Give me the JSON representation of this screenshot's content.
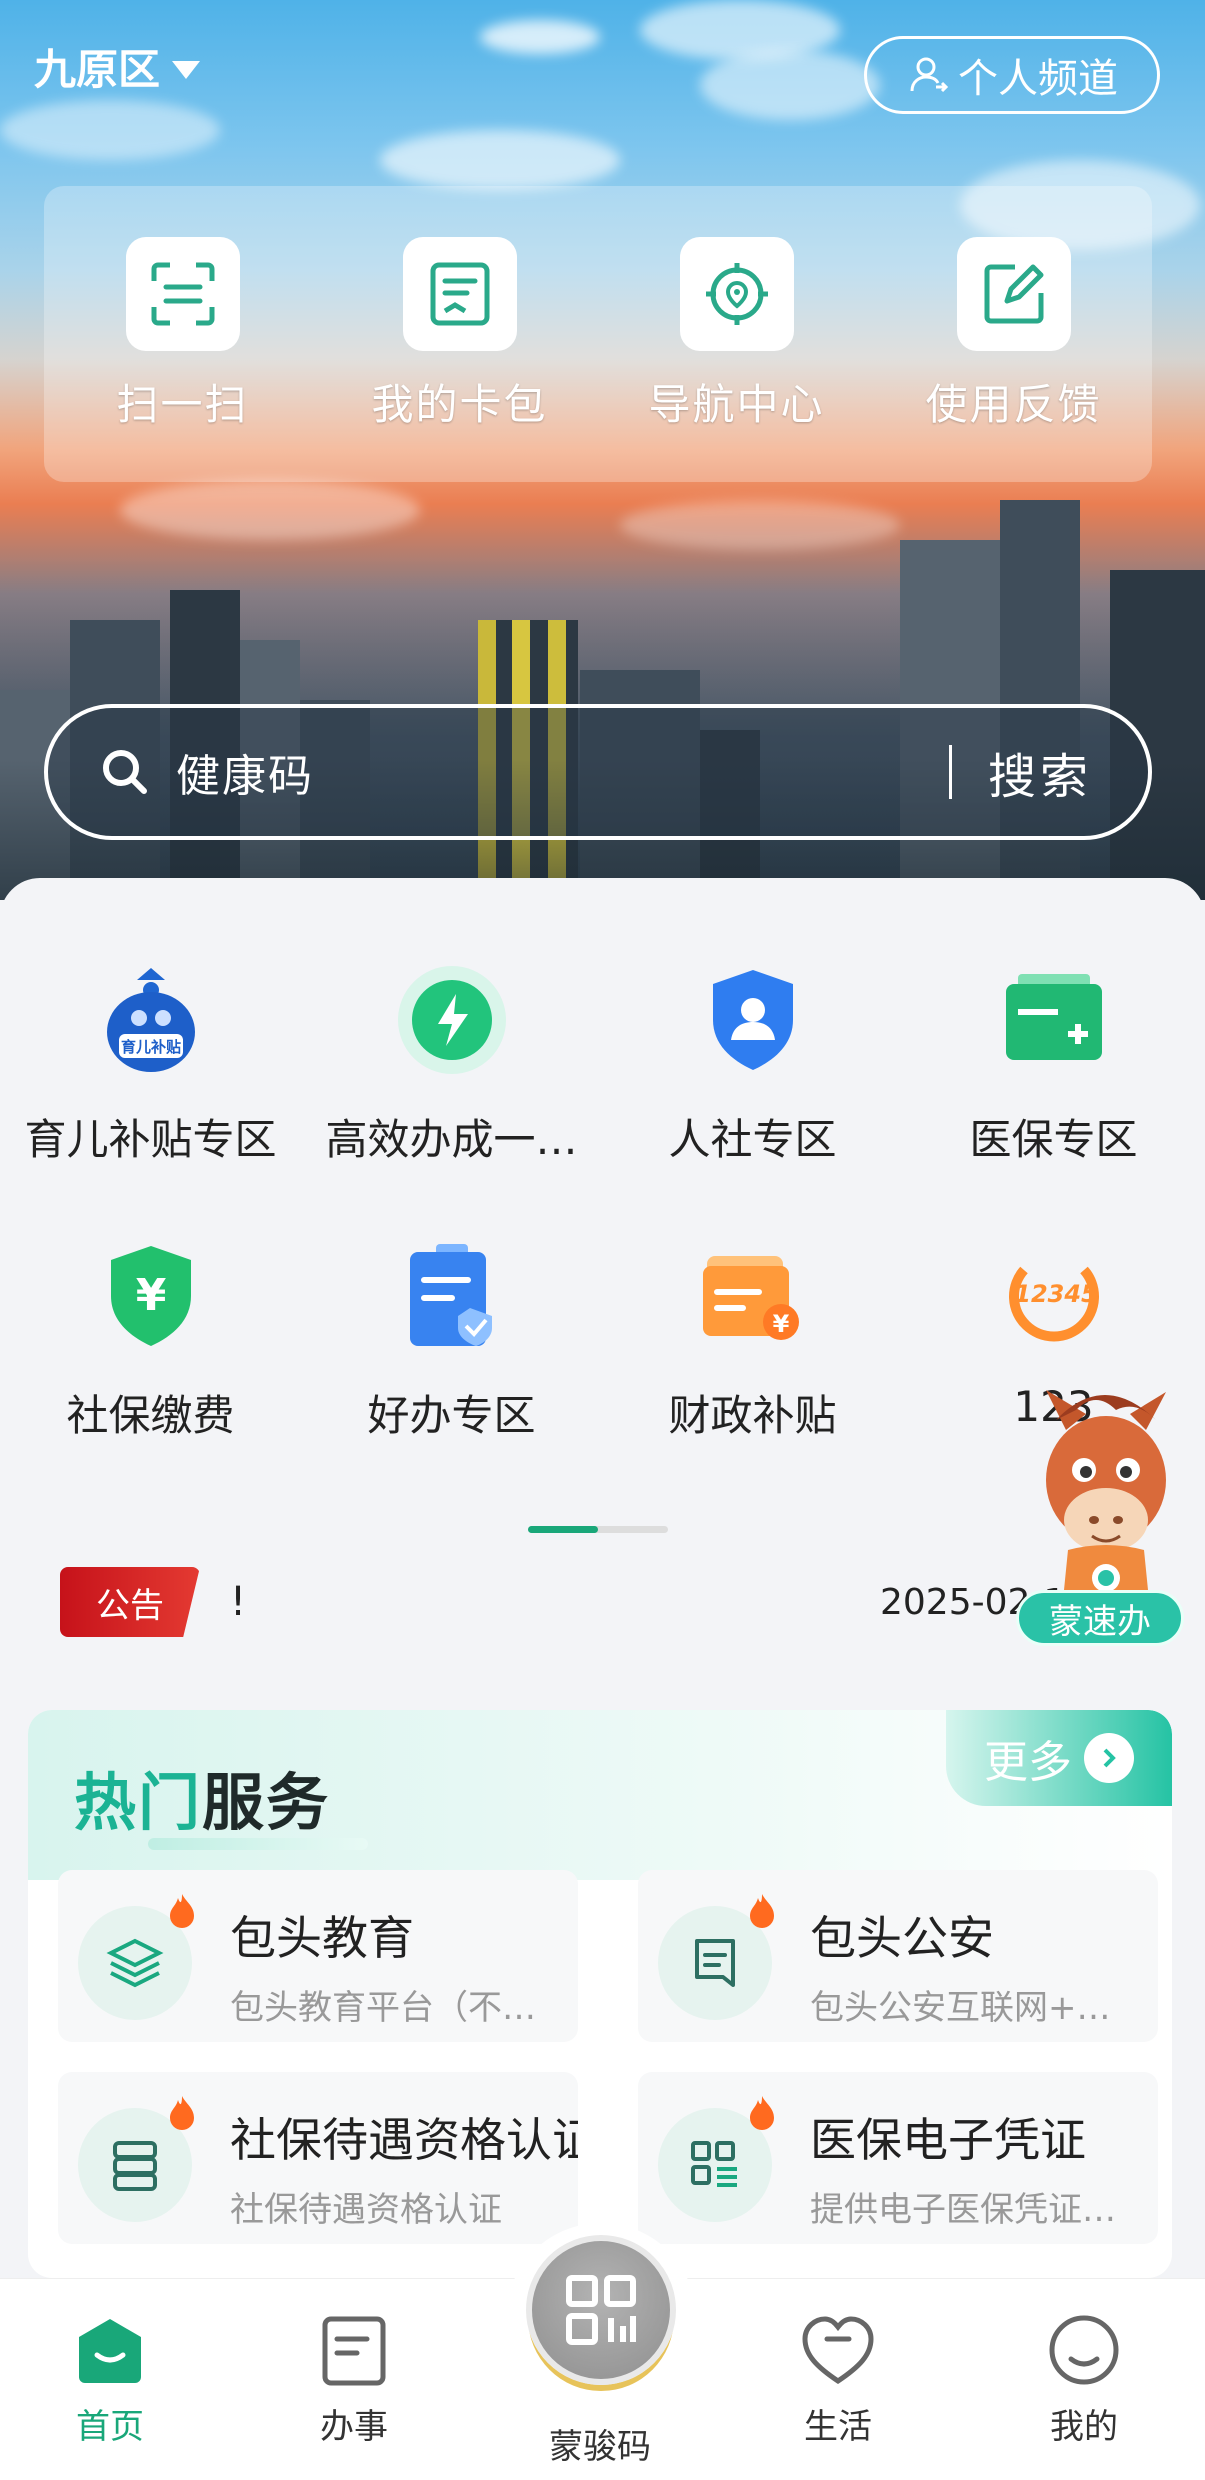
{
  "header": {
    "location": "九原区",
    "personal_channel": "个人频道"
  },
  "quick_actions": [
    {
      "label": "扫一扫",
      "icon": "scan-icon"
    },
    {
      "label": "我的卡包",
      "icon": "card-wallet-icon"
    },
    {
      "label": "导航中心",
      "icon": "navigation-target-icon"
    },
    {
      "label": "使用反馈",
      "icon": "feedback-edit-icon"
    }
  ],
  "search": {
    "placeholder": "健康码",
    "button": "搜索"
  },
  "service_grid": {
    "row1": [
      {
        "label": "育儿补贴专区",
        "icon": "childcare-subsidy-icon",
        "badge_text": "育儿补贴"
      },
      {
        "label": "高效办成一…",
        "icon": "lightning-icon"
      },
      {
        "label": "人社专区",
        "icon": "shield-person-icon"
      },
      {
        "label": "医保专区",
        "icon": "medical-card-icon"
      }
    ],
    "row2": [
      {
        "label": "社保缴费",
        "icon": "yuan-shield-icon"
      },
      {
        "label": "好办专区",
        "icon": "clipboard-check-icon"
      },
      {
        "label": "财政补贴",
        "icon": "wallet-yuan-icon"
      },
      {
        "label": "123",
        "icon": "hotline-12345-icon",
        "badge_text": "12345"
      }
    ]
  },
  "notice": {
    "tag": "公告",
    "text": "!",
    "date": "2025-02-1"
  },
  "mascot": {
    "label": "蒙速办"
  },
  "hot_services": {
    "title_a": "热门",
    "title_b": "服务",
    "more": "更多",
    "items": [
      {
        "title": "包头教育",
        "subtitle": "包头教育平台（不…",
        "icon": "layers-icon"
      },
      {
        "title": "包头公安",
        "subtitle": "包头公安互联网+…",
        "icon": "document-icon"
      },
      {
        "title": "社保待遇资格认证",
        "subtitle": "社保待遇资格认证",
        "icon": "database-icon"
      },
      {
        "title": "医保电子凭证",
        "subtitle": "提供电子医保凭证…",
        "icon": "grid-list-icon"
      }
    ]
  },
  "tabbar": {
    "home": "首页",
    "affairs": "办事",
    "code": "蒙骏码",
    "life": "生活",
    "mine": "我的"
  },
  "colors": {
    "accent": "#19a779",
    "notice_red": "#d01d22",
    "hot_green": "#1bb394"
  }
}
